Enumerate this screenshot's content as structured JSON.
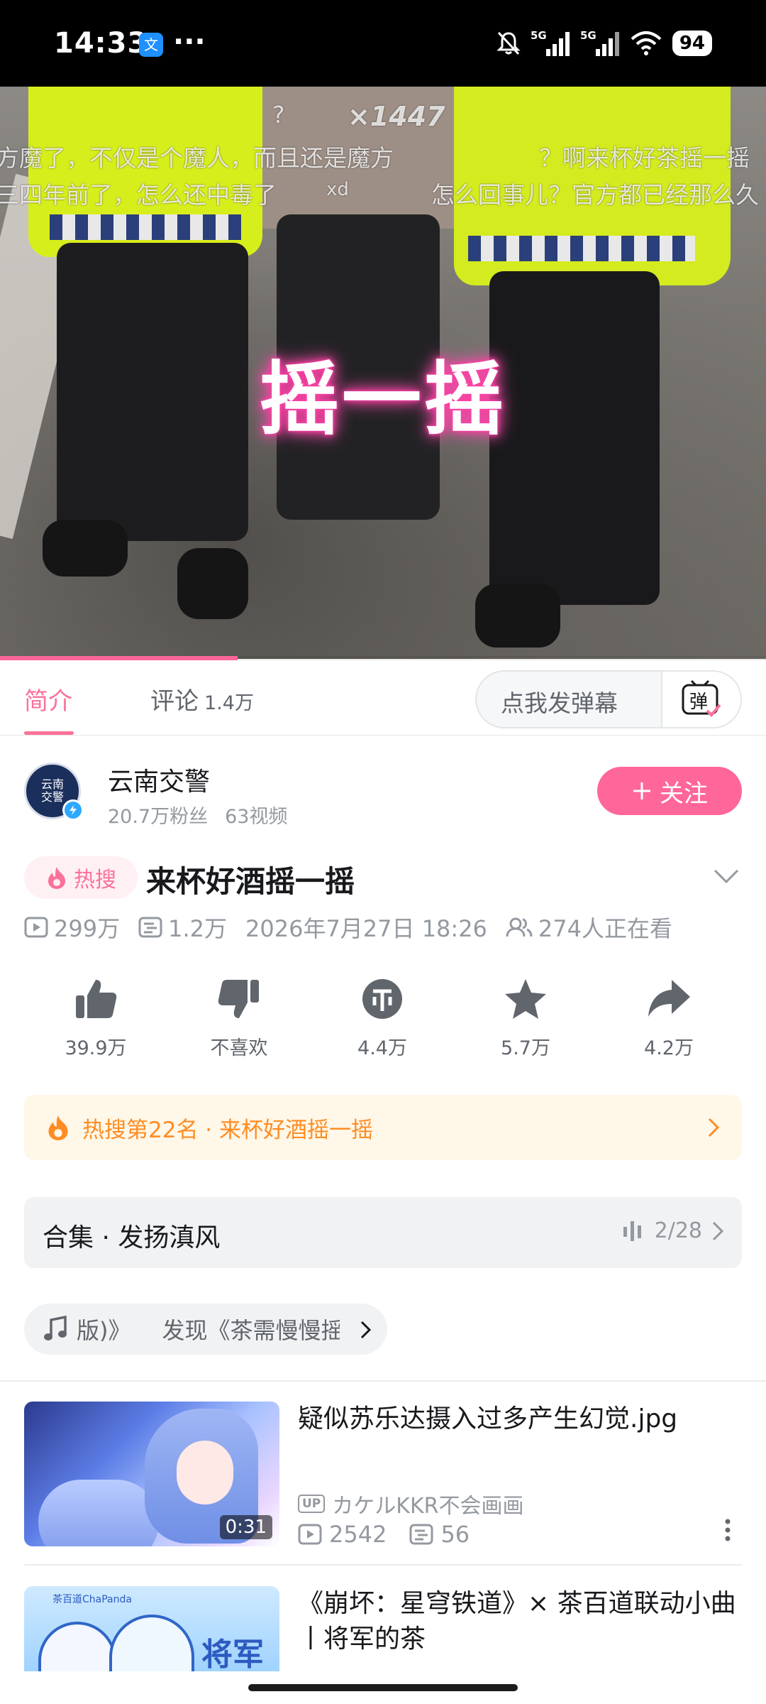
{
  "status_bar": {
    "time": "14:33",
    "app_icon": "文",
    "dots": "···",
    "battery": "94",
    "icons": [
      "mute-bell-icon",
      "signal-5g-icon",
      "signal-5g-icon",
      "wifi-icon"
    ]
  },
  "video": {
    "danmaku": [
      "?",
      "×1447",
      "方魔了，不仅是个魔人，而且还是魔方",
      "？啊来杯好茶摇一摇",
      "三四年前了，怎么还中毒了",
      "xd",
      "怎么回事儿？官方都已经那么久"
    ],
    "overlay_text": "摇一摇",
    "progress": 0.31
  },
  "tabs": {
    "intro": "简介",
    "comments": "评论",
    "comment_count": "1.4万",
    "danmaku_placeholder": "点我发弹幕",
    "danmaku_button": "弹"
  },
  "uploader": {
    "avatar_text": "云南交警",
    "name": "云南交警",
    "fans": "20.7万粉丝",
    "videos": "63视频",
    "follow_label": "关注"
  },
  "video_info": {
    "hot_tag": "热搜",
    "title": "来杯好酒摇一摇",
    "views": "299万",
    "danmaku_count": "1.2万",
    "date": "2026年7月27日 18:26",
    "watching": "274人正在看"
  },
  "actions": [
    {
      "icon": "thumbs-up-icon",
      "label": "39.9万"
    },
    {
      "icon": "thumbs-down-icon",
      "label": "不喜欢"
    },
    {
      "icon": "coin-icon",
      "label": "4.4万"
    },
    {
      "icon": "star-icon",
      "label": "5.7万"
    },
    {
      "icon": "share-icon",
      "label": "4.2万"
    }
  ],
  "hot_banner": {
    "text": "热搜第22名 · 来杯好酒摇一摇"
  },
  "collection": {
    "name": "合集 · 发扬滇风",
    "progress": "2/28"
  },
  "music": {
    "part1": "版)》",
    "part2": "发现《茶需慢慢摇"
  },
  "related": [
    {
      "title": "疑似苏乐达摄入过多产生幻觉.jpg",
      "duration": "0:31",
      "up_tag": "UP",
      "author": "カケルKKR不会画画",
      "views": "2542",
      "danmaku": "56"
    },
    {
      "title": "《崩坏：星穹铁道》× 茶百道联动小曲丨将军的茶",
      "thumb_text": "将军",
      "thumb_small": "茶百道ChaPanda"
    }
  ],
  "colors": {
    "accent_pink": "#fb7299",
    "follow_pink": "#ff6699",
    "hot_orange": "#ff8c22",
    "text_grey": "#9499a0"
  }
}
